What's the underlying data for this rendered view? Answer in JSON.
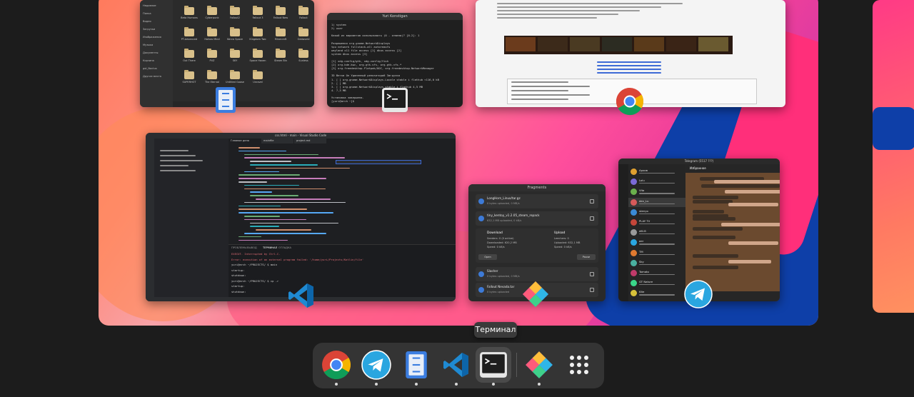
{
  "overview": {
    "tooltip": "Терминал"
  },
  "windows": {
    "files": {
      "folders": [
        "Beta Humans",
        "Cyberpunk",
        "Fallout2",
        "Fallout 3",
        "Fallout New",
        "Fallout",
        "PT-Advanced",
        "Hollow Mind",
        "Kenra Space",
        "Kingdom Two",
        "Minecraft",
        "Oddworld",
        "Out There",
        "PVZ",
        "SKY",
        "Space Haven",
        "Steam Bin",
        "Sunless",
        "SUPERHOT",
        "The Eternal",
        "Untitled Goose",
        "Unravel"
      ],
      "sidebar": [
        "Недавние",
        "Папка",
        "Видео",
        "Загрузки",
        "Изображения",
        "Музыка",
        "Документы",
        "Корзина",
        "gst_Noctus",
        "Другие места"
      ]
    },
    "terminal": {
      "title": "Yuri Konstigan",
      "lines": [
        "1) system",
        "2) user",
        "",
        "Какой из вариантов использовать (0 - отмена)? [0-2]: 1",
        "",
        "Разрешения org.gnome.NetworkDisplays",
        "  tpu        network    fullstack-all   autoreaxfu",
        "  wayland    x11        file access [1] dbus access [2]",
        "  system dbus access [3]",
        "",
        "  [1] xdg-config/gtk, xdg-config/fish",
        "  [2] org.kde.kwc, org.gtk.vfs, org.gtk.vfs.*",
        "  [3] org.freedesktop.Flatpak/OOC, org.freedesktop.NetworkManager",
        "",
        "     ID        Ветка  Оп Удаленный репозиторий Загрузка",
        "1. [ ] org.gnome.NetworkDisplays.Locale stable i flathub   <116,0 kB",
        "2. [ ] MB",
        "3. [ ] org.gnome.NetworkDisplays stable i flathub     4,5 MB",
        "4. 7,3 MB",
        "",
        "Установка завершена.",
        "[yuri@arch ~]$"
      ]
    },
    "chrome": {},
    "vscode": {
      "title": "css.html - main - Visual Studio Code",
      "tabs": [
        "Главное дело",
        "mainfile",
        "project.md"
      ],
      "terminal_tabs": [
        "ПРОБЛЕМЫ",
        "ВЫВОД",
        "ТЕРМИНАЛ",
        "ОТЛАДКА"
      ],
      "terminal_lines": [
        "EXECUT. Interrupted by Ctrl-C.",
        "Error: execution of an external program failed: '/home/yuri/Projects/Kotlin/file'",
        "yuri@arch ~/PROJECTS/ $ main",
        "startup:",
        "shutdown:",
        "yuri@arch ~/PROJECTS/ $ cp -r",
        "startup:",
        "shutdown:"
      ]
    },
    "fragments": {
      "title": "Fragments",
      "torrents": [
        {
          "name": "LongHorn_Linux/tar.gz",
          "status": "0 bytes uploaded, 0 MB/s"
        },
        {
          "name": "tiny_kentoy_v1.2.05_steam_repack",
          "status": "632,1 MB uploaded, 0 kB/s"
        },
        {
          "name": "Slasher",
          "status": "0 bytes uploaded, 0 MB/s"
        },
        {
          "name": "Fallout Nevada.tar",
          "status": "0 bytes uploaded"
        }
      ],
      "download_label": "Download",
      "upload_label": "Upload",
      "download_stats": [
        "Seeders: 0 (0 active)",
        "Downloaded: 620,2 MB",
        "Speed: 0 kB/s"
      ],
      "upload_stats": [
        "Leechers: 0",
        "Uploaded: 632,1 MB",
        "Speed: 0 kB/s"
      ],
      "buttons": [
        "Open",
        "Pause"
      ]
    },
    "telegram": {
      "title": "Telegram (5517 ???)",
      "chat_title": "Избранное",
      "chats": [
        "Архив",
        "Lolu",
        "Vita",
        "dev_Lu",
        "stenyo",
        "PLAY TV",
        "d6l.B",
        "aer",
        "TM",
        "Sky",
        "Tomato",
        "GT Nature",
        "Kite"
      ]
    }
  },
  "dock": {
    "items": [
      {
        "name": "Google Chrome",
        "icon": "chrome-icon"
      },
      {
        "name": "Telegram",
        "icon": "telegram-icon"
      },
      {
        "name": "Files",
        "icon": "files-icon"
      },
      {
        "name": "Visual Studio Code",
        "icon": "vscode-icon"
      },
      {
        "name": "Терминал",
        "icon": "terminal-icon"
      },
      {
        "name": "Fragments",
        "icon": "fragments-icon"
      },
      {
        "name": "Show Applications",
        "icon": "app-grid-icon"
      }
    ]
  },
  "colors": {
    "dock_bg": "#343434",
    "overview_bg": "#1c1c1c",
    "accent_blue": "#2aa6e0"
  }
}
